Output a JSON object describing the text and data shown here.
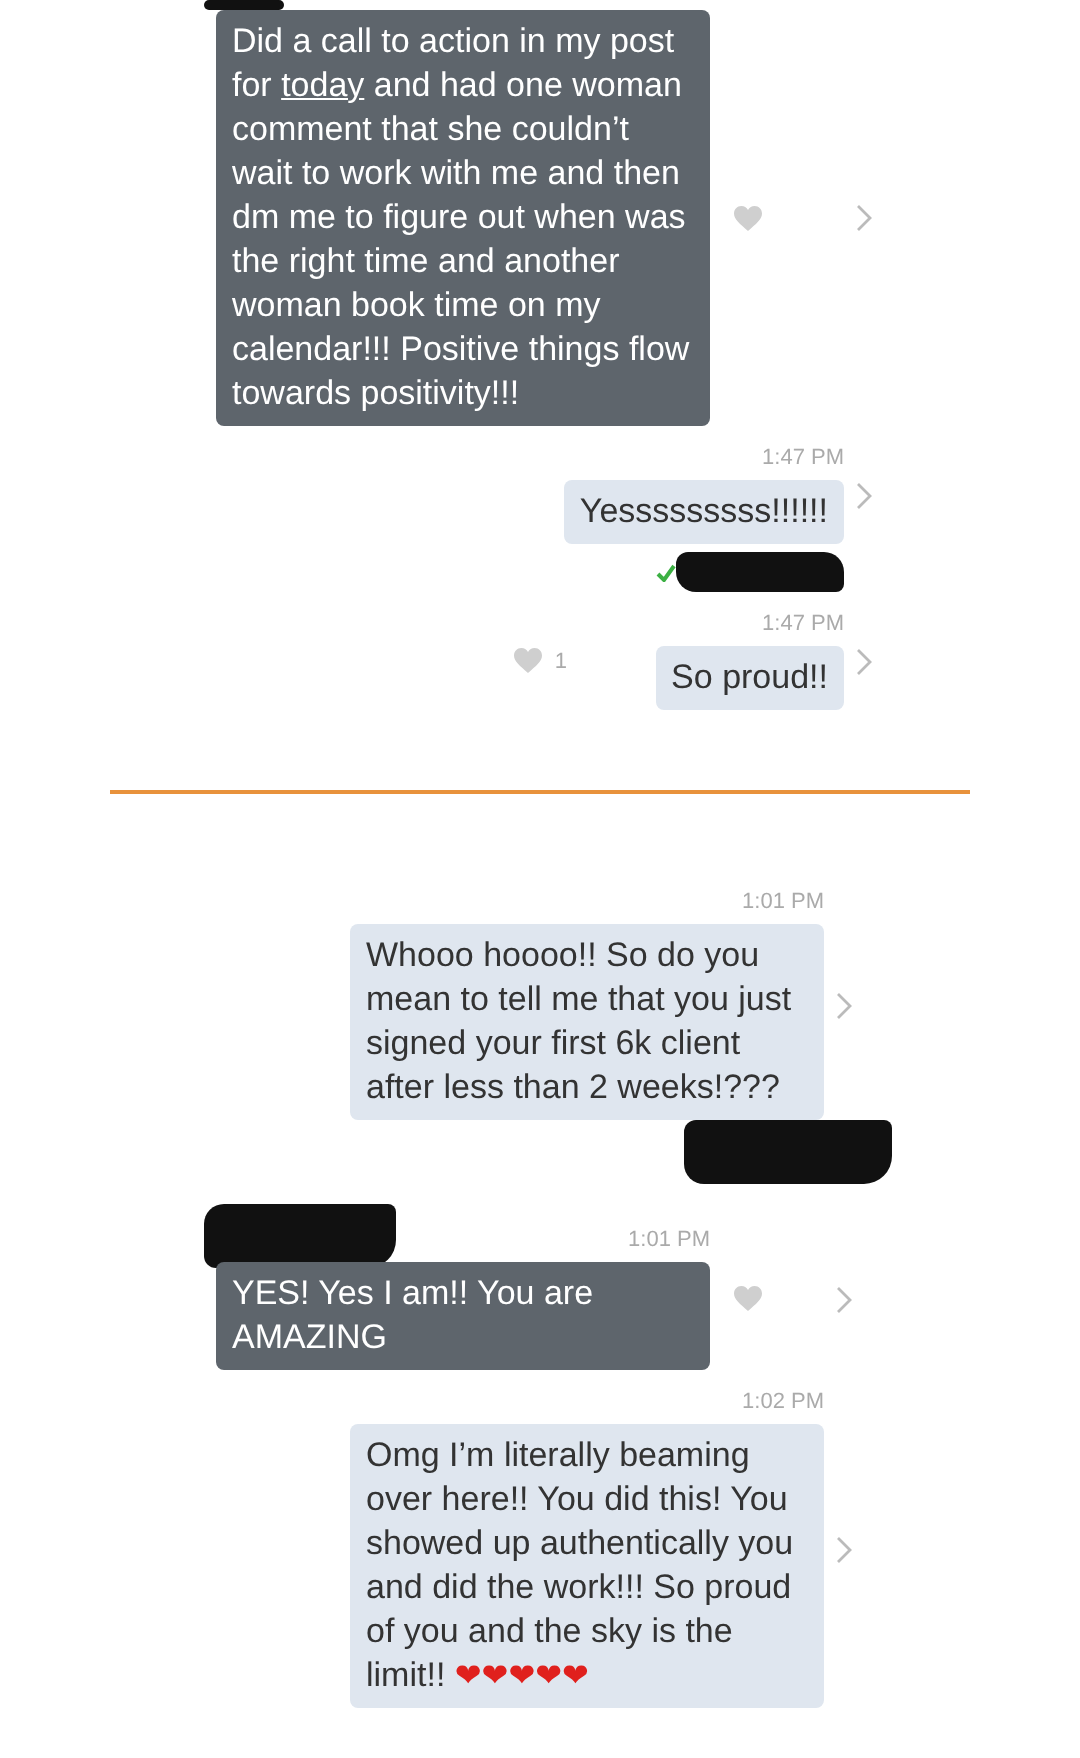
{
  "sections": [
    {
      "items": [
        {
          "kind": "incoming",
          "redacted_above": true,
          "segments": [
            {
              "text": "Did a call to action in my post for ",
              "link": false
            },
            {
              "text": "today",
              "link": true
            },
            {
              "text": " and had one woman comment that she couldn’t wait to work with me and then dm me to figure out when was the right time and another woman book time on my calendar!!! Positive things flow towards positivity!!!",
              "link": false
            }
          ],
          "heart": true,
          "chevron": true
        },
        {
          "kind": "outgoing",
          "time": "1:47 PM",
          "segments": [
            {
              "text": "Yesssssssss!!!!!!",
              "link": false
            }
          ],
          "heart": false,
          "chevron": true
        },
        {
          "kind": "receipt",
          "read": true
        },
        {
          "kind": "outgoing",
          "time": "1:47 PM",
          "segments": [
            {
              "text": "So proud!!",
              "link": false
            }
          ],
          "heart": true,
          "like_count": "1",
          "chevron": true
        }
      ]
    },
    {
      "items": [
        {
          "kind": "outgoing",
          "time": "1:01 PM",
          "redacted_below": true,
          "segments": [
            {
              "text": "Whooo hoooo!! So do you mean to tell me that you just signed your first 6k client after less than 2 weeks!???",
              "link": false
            }
          ],
          "heart": false,
          "chevron": true
        },
        {
          "kind": "incoming",
          "time": "1:01 PM",
          "redacted_above": true,
          "segments": [
            {
              "text": "YES! Yes I am!! You are AMAZING",
              "link": false
            }
          ],
          "heart": true,
          "chevron": true
        },
        {
          "kind": "outgoing",
          "time": "1:02 PM",
          "segments": [
            {
              "text": "Omg I’m literally beaming over here!! You did this! You showed up authentically you and did the work!!! So proud of you and the sky is the limit!! ",
              "link": false
            }
          ],
          "emoji": "❤❤❤❤❤",
          "heart": false,
          "chevron": true
        }
      ]
    }
  ]
}
